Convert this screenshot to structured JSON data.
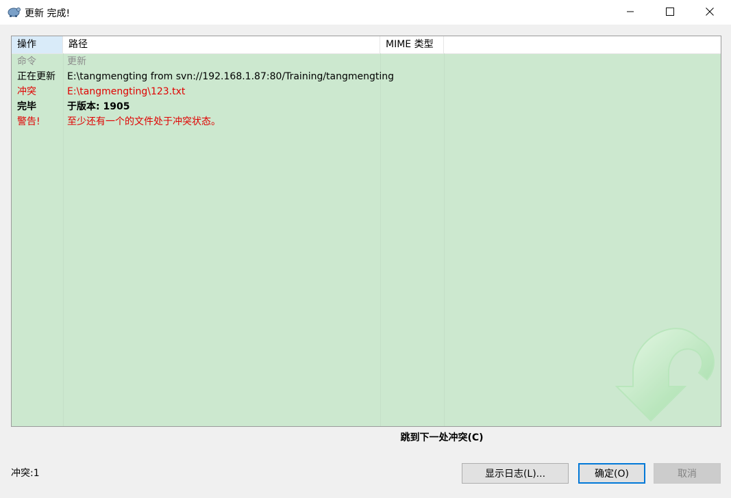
{
  "window": {
    "title": "更新 完成!",
    "icon": "tortoise-svn-icon"
  },
  "table": {
    "columns": [
      "操作",
      "路径",
      "MIME 类型",
      ""
    ],
    "rows": [
      {
        "action": "命令",
        "path": "更新",
        "style": "gray"
      },
      {
        "action": "正在更新",
        "path": "E:\\tangmengting from svn://192.168.1.87:80/Training/tangmengting",
        "style": "normal"
      },
      {
        "action": "冲突",
        "path": "E:\\tangmengting\\123.txt",
        "style": "red"
      },
      {
        "action": "完毕",
        "path": "于版本: 1905",
        "style": "bold"
      },
      {
        "action": "警告!",
        "path": "至少还有一个的文件处于冲突状态。",
        "style": "red"
      }
    ]
  },
  "links": {
    "next_conflict": "跳到下一处冲突(C)"
  },
  "status": {
    "conflicts": "冲突:1"
  },
  "buttons": {
    "show_log": "显示日志(L)...",
    "ok": "确定(O)",
    "cancel": "取消"
  },
  "colors": {
    "list_background": "#cce8cf",
    "conflict_red": "#e00000",
    "accent_blue": "#0078d7"
  }
}
